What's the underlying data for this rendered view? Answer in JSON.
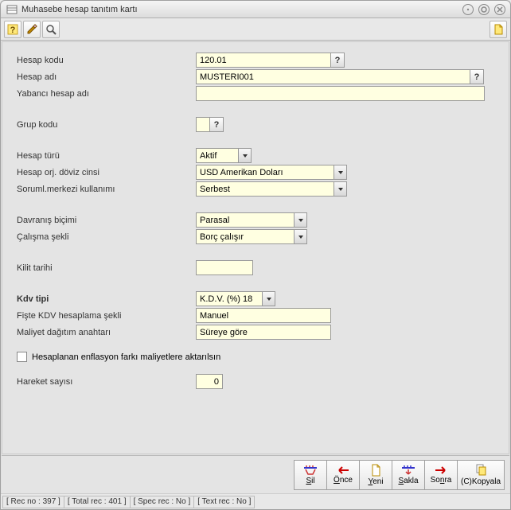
{
  "window": {
    "title": "Muhasebe hesap tanıtım kartı"
  },
  "fields": {
    "hesap_kodu_lbl": "Hesap kodu",
    "hesap_kodu_val": "120.01",
    "hesap_adi_lbl": "Hesap adı",
    "hesap_adi_val": "MUSTERI001",
    "yabanci_lbl": "Yabancı hesap adı",
    "yabanci_val": "",
    "grup_lbl": "Grup kodu",
    "grup_val": "",
    "hesap_turu_lbl": "Hesap türü",
    "hesap_turu_val": "Aktif",
    "doviz_lbl": "Hesap orj. döviz cinsi",
    "doviz_val": "USD Amerikan Doları",
    "soruml_lbl": "Soruml.merkezi kullanımı",
    "soruml_val": "Serbest",
    "davranis_lbl": "Davranış biçimi",
    "davranis_val": "Parasal",
    "calisma_lbl": "Çalışma şekli",
    "calisma_val": "Borç çalışır",
    "kilit_lbl": "Kilit tarihi",
    "kilit_val": "",
    "kdv_lbl": "Kdv tipi",
    "kdv_val": "K.D.V. (%) 18",
    "fiste_lbl": "Fişte KDV hesaplama şekli",
    "fiste_val": "Manuel",
    "maliyet_lbl": "Maliyet dağıtım anahtarı",
    "maliyet_val": "Süreye göre",
    "enflasyon_chk": "Hesaplanan enflasyon farkı maliyetlere aktarılsın",
    "hareket_lbl": "Hareket sayısı",
    "hareket_val": "0"
  },
  "buttons": {
    "sil": "Sil",
    "once": "Önce",
    "yeni": "Yeni",
    "sakla": "Sakla",
    "sonra": "Sonra",
    "kopyala": "(C)Kopyala"
  },
  "status": {
    "rec_no": "[ Rec no : 397 ]",
    "total_rec": "[ Total rec : 401 ]",
    "spec_rec": "[ Spec rec : No ]",
    "text_rec": "[ Text rec : No ]"
  }
}
